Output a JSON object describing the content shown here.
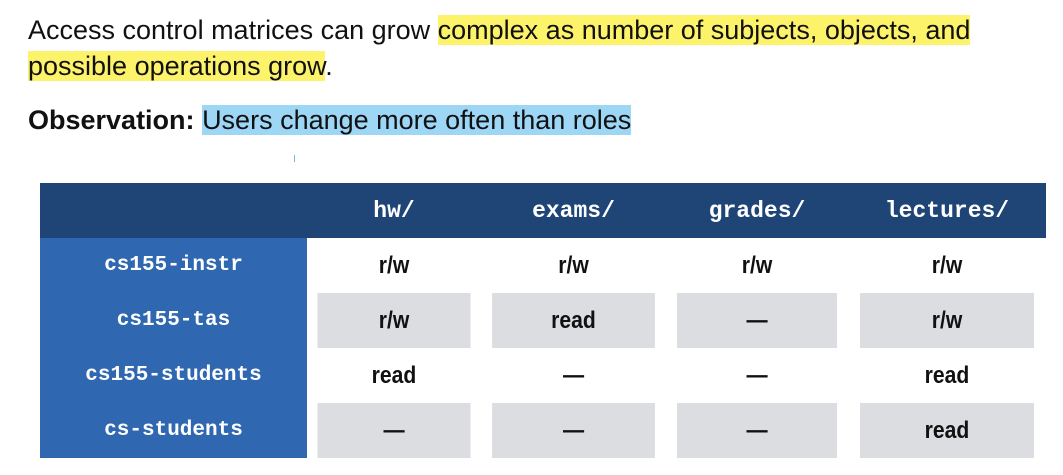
{
  "intro": {
    "text_before": "Access control matrices can grow ",
    "highlight": "complex as number of subjects, objects, and possible operations grow",
    "text_after": "."
  },
  "observation": {
    "label": "Observation:",
    "highlight": "Users change more often than roles"
  },
  "colors": {
    "yellow_highlight": "#fdf36b",
    "blue_highlight": "#9dd7f5",
    "header_bg": "#1f4577",
    "row_header_bg": "#2f67b1",
    "alt_row_bg": "#dcdde1"
  },
  "matrix": {
    "columns": [
      "hw/",
      "exams/",
      "grades/",
      "lectures/"
    ],
    "rows": [
      {
        "role": "cs155-instr",
        "cells": [
          "r/w",
          "r/w",
          "r/w",
          "r/w"
        ]
      },
      {
        "role": "cs155-tas",
        "cells": [
          "r/w",
          "read",
          "—",
          "r/w"
        ]
      },
      {
        "role": "cs155-students",
        "cells": [
          "read",
          "—",
          "—",
          "read"
        ]
      },
      {
        "role": "cs-students",
        "cells": [
          "—",
          "—",
          "—",
          "read"
        ]
      }
    ]
  }
}
